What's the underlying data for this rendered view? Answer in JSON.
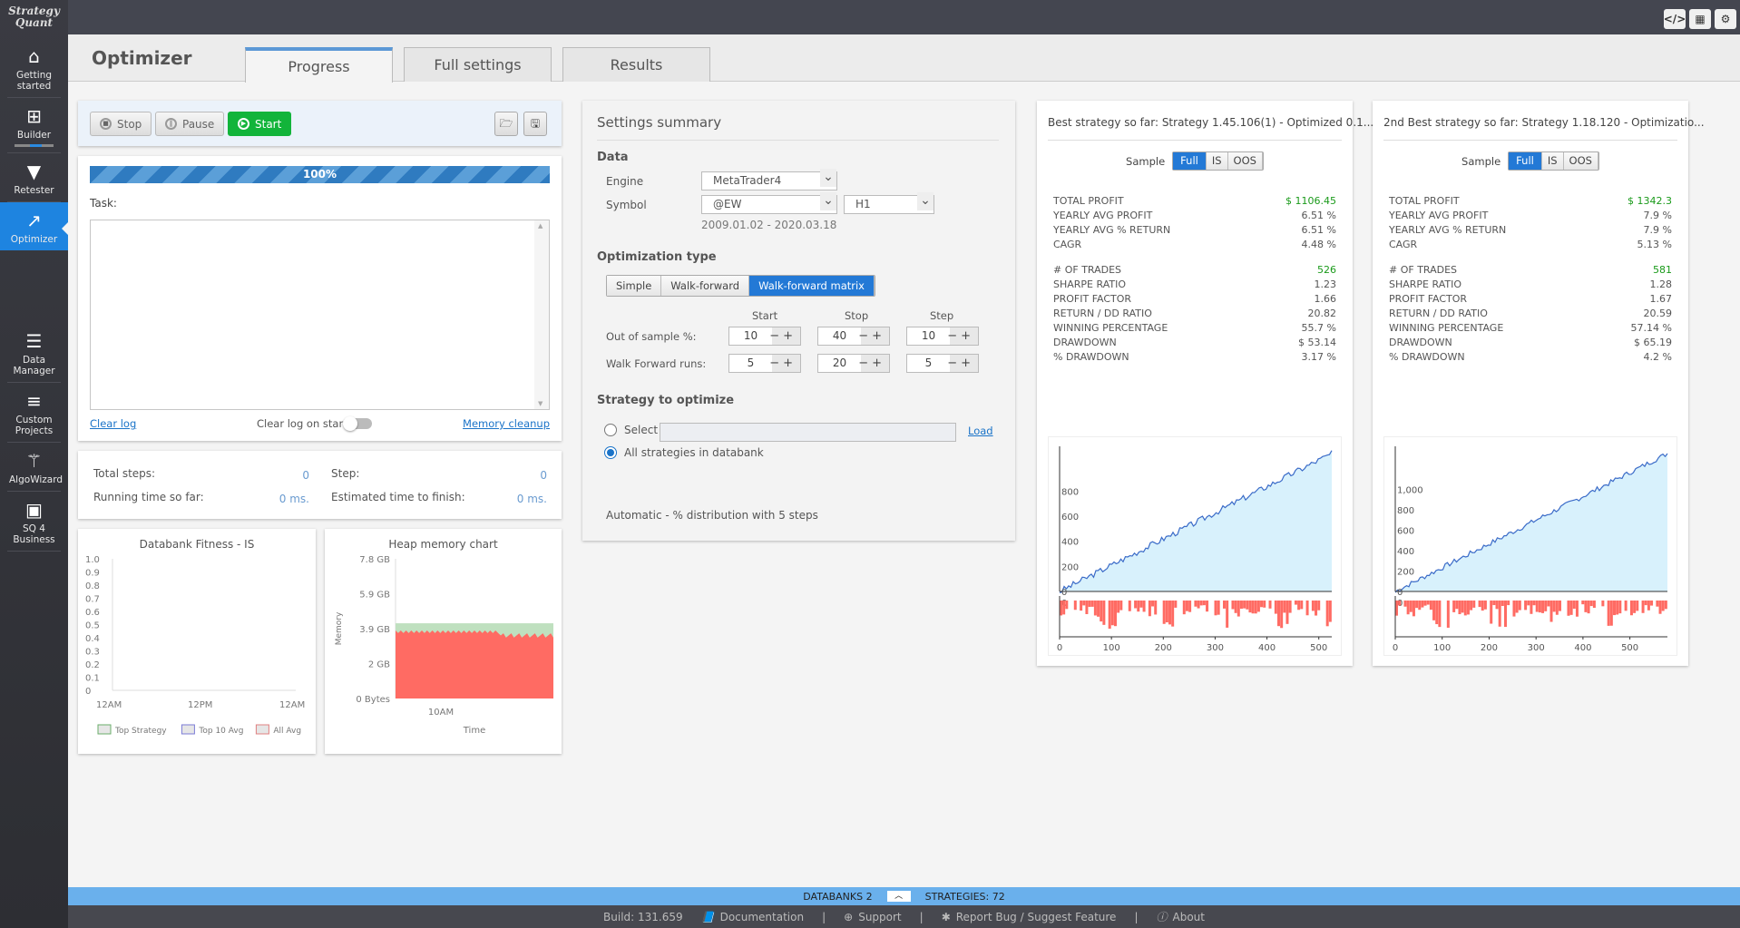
{
  "app": {
    "logo_line1": "Strategy",
    "logo_line2": "Quant"
  },
  "sidebar": {
    "items": [
      {
        "label": "Getting started",
        "icon": "home-icon"
      },
      {
        "label": "Builder",
        "icon": "plus-square-icon"
      },
      {
        "label": "Retester",
        "icon": "filter-icon"
      },
      {
        "label": "Optimizer",
        "icon": "chart-line-icon",
        "active": true
      },
      {
        "label": "Data Manager",
        "icon": "database-icon"
      },
      {
        "label": "Custom Projects",
        "icon": "server-icon"
      },
      {
        "label": "AlgoWizard",
        "icon": "magic-wand-icon"
      },
      {
        "label": "SQ 4 Business",
        "icon": "briefcase-icon"
      }
    ]
  },
  "header": {
    "title": "Optimizer",
    "tabs": [
      {
        "label": "Progress",
        "active": true
      },
      {
        "label": "Full settings"
      },
      {
        "label": "Results"
      }
    ]
  },
  "controls": {
    "stop": "Stop",
    "pause": "Pause",
    "start": "Start"
  },
  "progress": {
    "percent_label": "100%",
    "value": 1.0,
    "task_label": "Task:",
    "clear_log": "Clear log",
    "clear_on_start": "Clear log on start",
    "clear_on_start_enabled": false,
    "memory_cleanup": "Memory cleanup"
  },
  "stats": {
    "total_steps_label": "Total steps:",
    "total_steps": "0",
    "step_label": "Step:",
    "step": "0",
    "running_label": "Running time so far:",
    "running": "0 ms.",
    "estimated_label": "Estimated time to finish:",
    "estimated": "0 ms."
  },
  "fitness_chart": {
    "title": "Databank Fitness - IS",
    "yticks": [
      "1.0",
      "0.9",
      "0.8",
      "0.7",
      "0.6",
      "0.5",
      "0.4",
      "0.3",
      "0.2",
      "0.1",
      "0"
    ],
    "xticks": [
      "12AM",
      "12PM",
      "12AM"
    ],
    "legend": [
      "Top Strategy",
      "Top 10 Avg",
      "All Avg"
    ]
  },
  "heap_chart": {
    "title": "Heap memory chart",
    "yticks": [
      "7.8 GB",
      "5.9 GB",
      "3.9 GB",
      "2 GB",
      "0 Bytes"
    ],
    "xticks": [
      "10AM"
    ],
    "ylabel": "Memory",
    "xlabel": "Time"
  },
  "settings": {
    "title": "Settings summary",
    "data_heading": "Data",
    "engine_label": "Engine",
    "engine": "MetaTrader4",
    "symbol_label": "Symbol",
    "symbol": "@EW",
    "timeframe": "H1",
    "date_range": "2009.01.02 - 2020.03.18",
    "opt_heading": "Optimization type",
    "opt_types": [
      "Simple",
      "Walk-forward",
      "Walk-forward matrix"
    ],
    "opt_selected": "Walk-forward matrix",
    "col_start": "Start",
    "col_stop": "Stop",
    "col_step": "Step",
    "oos_label": "Out of sample %:",
    "oos": [
      "10",
      "40",
      "10"
    ],
    "wfr_label": "Walk Forward runs:",
    "wfr": [
      "5",
      "20",
      "5"
    ],
    "strat_heading": "Strategy to optimize",
    "select_label": "Select",
    "select_value": "",
    "load": "Load",
    "all_label": "All strategies in databank",
    "auto_text": "Automatic - % distribution with 5 steps"
  },
  "best": [
    {
      "title": "Best strategy so far: Strategy 1.45.106(1) - Optimized 0.1...",
      "sample_label": "Sample",
      "samples": [
        "Full",
        "IS",
        "OOS"
      ],
      "metrics1": [
        [
          "TOTAL PROFIT",
          "$ 1106.45"
        ],
        [
          "YEARLY AVG PROFIT",
          "6.51 %"
        ],
        [
          "YEARLY AVG % RETURN",
          "6.51 %"
        ],
        [
          "CAGR",
          "4.48 %"
        ]
      ],
      "metrics2": [
        [
          "# OF TRADES",
          "526"
        ],
        [
          "SHARPE RATIO",
          "1.23"
        ],
        [
          "PROFIT FACTOR",
          "1.66"
        ],
        [
          "RETURN / DD RATIO",
          "20.82"
        ],
        [
          "WINNING PERCENTAGE",
          "55.7 %"
        ],
        [
          "DRAWDOWN",
          "$ 53.14"
        ],
        [
          "% DRAWDOWN",
          "3.17 %"
        ]
      ],
      "yticks": [
        "800",
        "600",
        "400",
        "200",
        "0"
      ],
      "xticks": [
        "0",
        "100",
        "200",
        "300",
        "400",
        "500"
      ],
      "dd_zero": "0"
    },
    {
      "title": "2nd Best strategy so far: Strategy 1.18.120 - Optimizatio...",
      "sample_label": "Sample",
      "samples": [
        "Full",
        "IS",
        "OOS"
      ],
      "metrics1": [
        [
          "TOTAL PROFIT",
          "$ 1342.3"
        ],
        [
          "YEARLY AVG PROFIT",
          "7.9 %"
        ],
        [
          "YEARLY AVG % RETURN",
          "7.9 %"
        ],
        [
          "CAGR",
          "5.13 %"
        ]
      ],
      "metrics2": [
        [
          "# OF TRADES",
          "581"
        ],
        [
          "SHARPE RATIO",
          "1.28"
        ],
        [
          "PROFIT FACTOR",
          "1.67"
        ],
        [
          "RETURN / DD RATIO",
          "20.59"
        ],
        [
          "WINNING PERCENTAGE",
          "57.14 %"
        ],
        [
          "DRAWDOWN",
          "$ 65.19"
        ],
        [
          "% DRAWDOWN",
          "4.2 %"
        ]
      ],
      "yticks": [
        "1,000",
        "800",
        "600",
        "400",
        "200",
        "0"
      ],
      "xticks": [
        "0",
        "100",
        "200",
        "300",
        "400",
        "500"
      ],
      "dd_zero": "0"
    }
  ],
  "footer": {
    "databanks": "DATABANKS 2",
    "strategies": "STRATEGIES: 72",
    "build": "Build: 131.659",
    "documentation": "Documentation",
    "support": "Support",
    "report": "Report Bug / Suggest Feature",
    "about": "About"
  }
}
